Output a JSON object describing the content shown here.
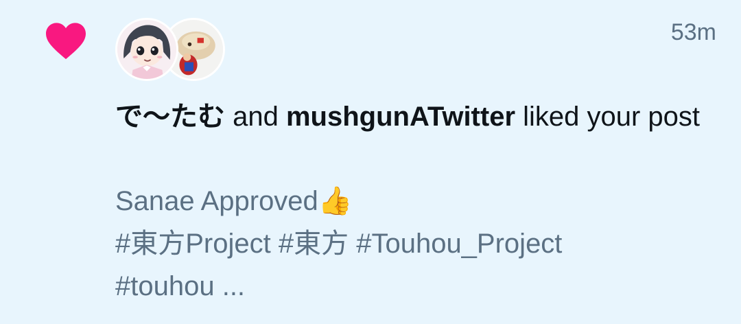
{
  "notification": {
    "time": "53m",
    "user1": "で〜たむ",
    "joiner": " and ",
    "user2": "mushgunATwitter",
    "action": " liked your post",
    "post_line1": "Sanae Approved👍",
    "post_line2": "#東方Project #東方 #Touhou_Project",
    "post_line3": "#touhou ..."
  },
  "icons": {
    "reaction": "heart-icon"
  },
  "colors": {
    "heart": "#f91880",
    "background": "#e8f5fd",
    "muted": "#5b7083",
    "text": "#0f1419"
  }
}
